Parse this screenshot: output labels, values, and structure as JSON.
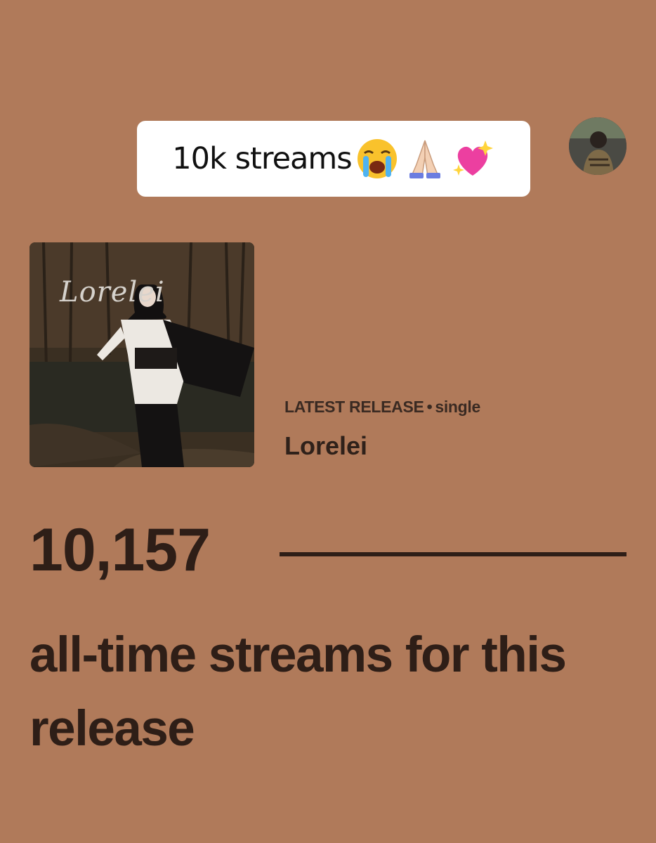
{
  "caption": {
    "text": "10k streams",
    "emojis": [
      "loudly-crying-face",
      "folded-hands",
      "sparkling-heart"
    ]
  },
  "avatar": {
    "description": "profile-photo"
  },
  "album": {
    "cover_script_title": "Lorelei"
  },
  "release": {
    "kind_label": "LATEST RELEASE",
    "separator": "•",
    "kind_type": "single",
    "name": "Lorelei"
  },
  "stats": {
    "count": "10,157",
    "label": "all-time streams for this release"
  },
  "colors": {
    "background": "#b07a5a",
    "text": "#2e1e17",
    "caption_bg": "#ffffff"
  }
}
